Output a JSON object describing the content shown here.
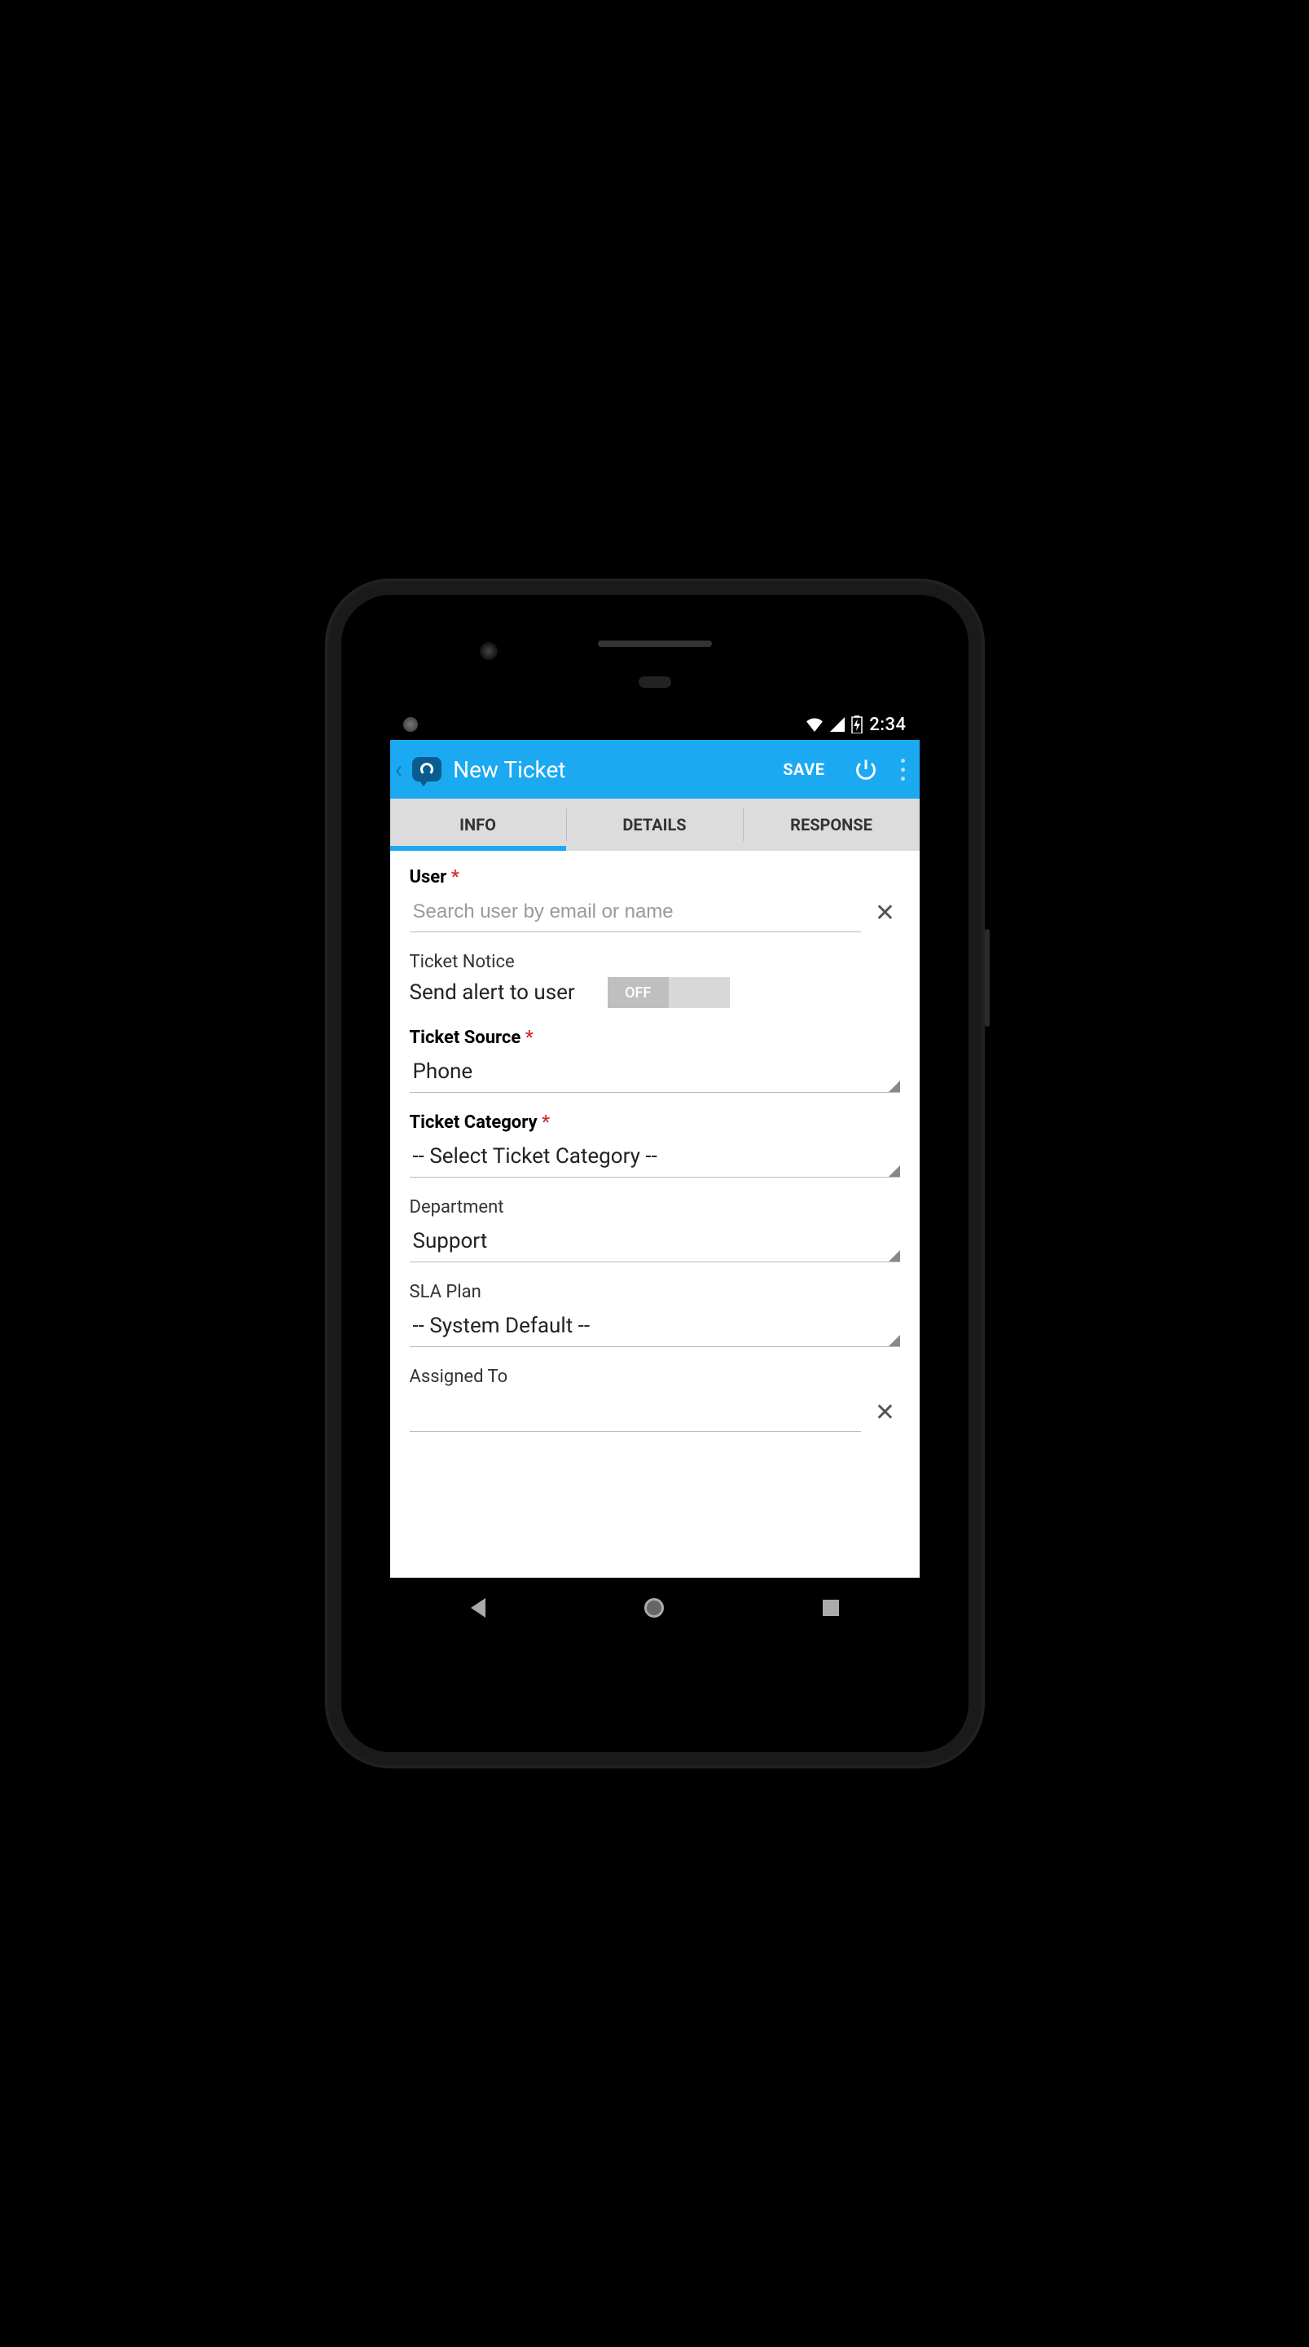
{
  "status": {
    "time": "2:34"
  },
  "appbar": {
    "title": "New Ticket",
    "save": "SAVE"
  },
  "tabs": {
    "info": "INFO",
    "details": "DETAILS",
    "response": "RESPONSE"
  },
  "form": {
    "user": {
      "label": "User",
      "placeholder": "Search user by email or name"
    },
    "notice": {
      "label": "Ticket Notice",
      "text": "Send alert to user",
      "toggle": "OFF"
    },
    "source": {
      "label": "Ticket Source",
      "value": "Phone"
    },
    "category": {
      "label": "Ticket Category",
      "value": "-- Select Ticket Category --"
    },
    "department": {
      "label": "Department",
      "value": "Support"
    },
    "sla": {
      "label": "SLA Plan",
      "value": "-- System Default --"
    },
    "assigned": {
      "label": "Assigned To",
      "value": ""
    }
  }
}
